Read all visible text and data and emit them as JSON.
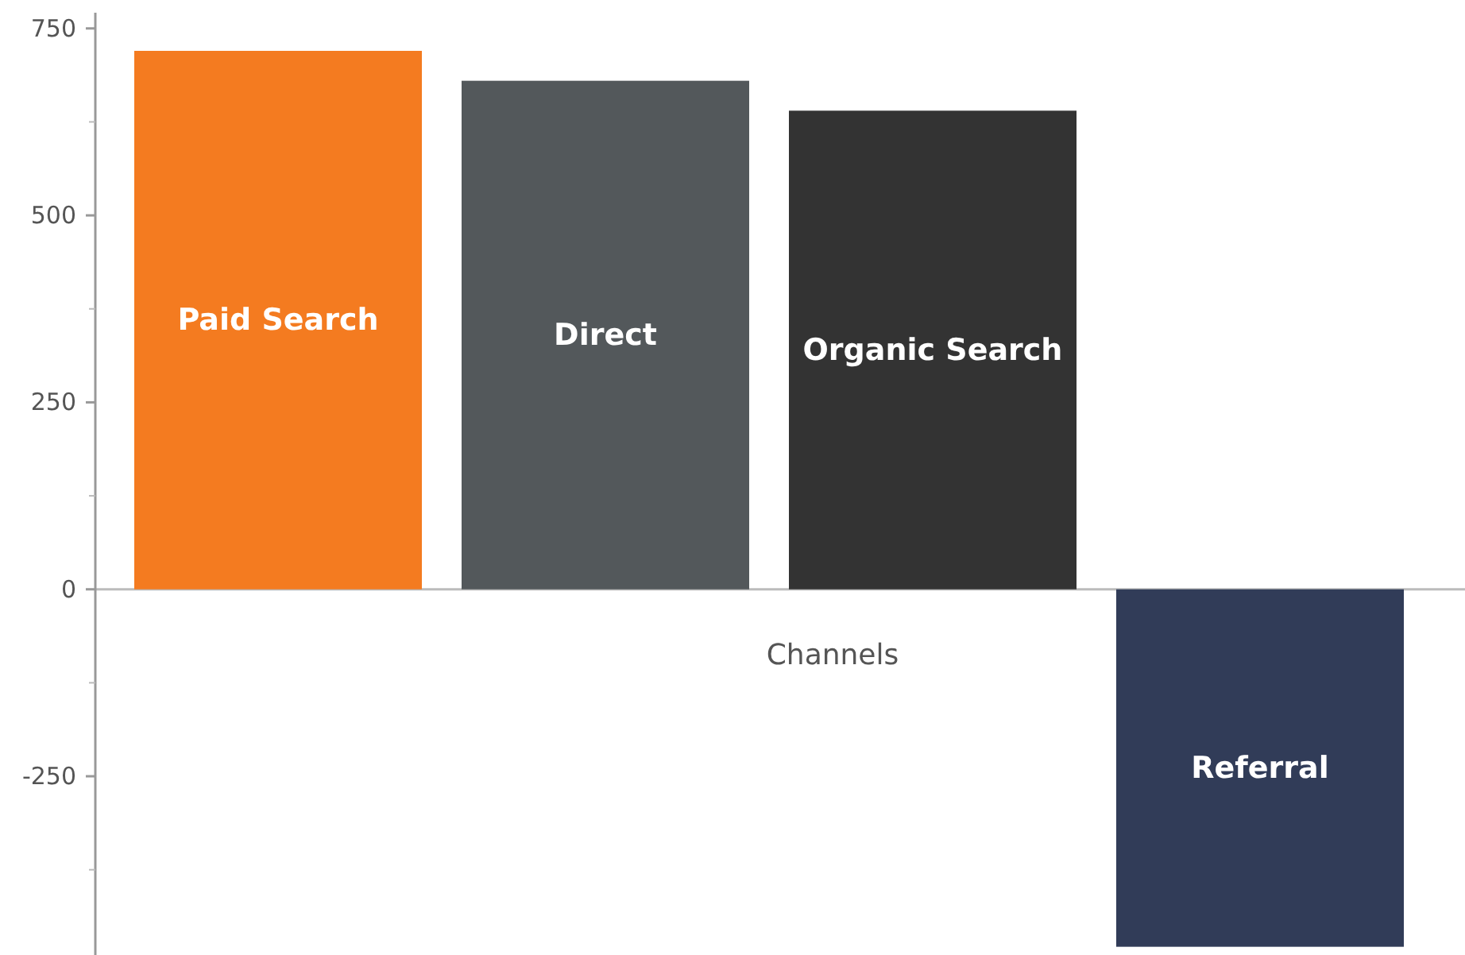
{
  "chart": {
    "chart_data": {
      "type": "bar",
      "categories": [
        "Channels"
      ],
      "series": [
        {
          "name": "Paid Search",
          "color": "#f47b20",
          "values": [
            720
          ]
        },
        {
          "name": "Direct",
          "color": "#53585b",
          "values": [
            680
          ]
        },
        {
          "name": "Organic Search",
          "color": "#333333",
          "values": [
            640
          ]
        },
        {
          "name": "Referral",
          "color": "#313c58",
          "values": [
            -478
          ]
        }
      ],
      "ylim": [
        -489,
        788
      ],
      "yticks": [
        -250,
        0,
        250,
        500,
        750
      ]
    }
  }
}
